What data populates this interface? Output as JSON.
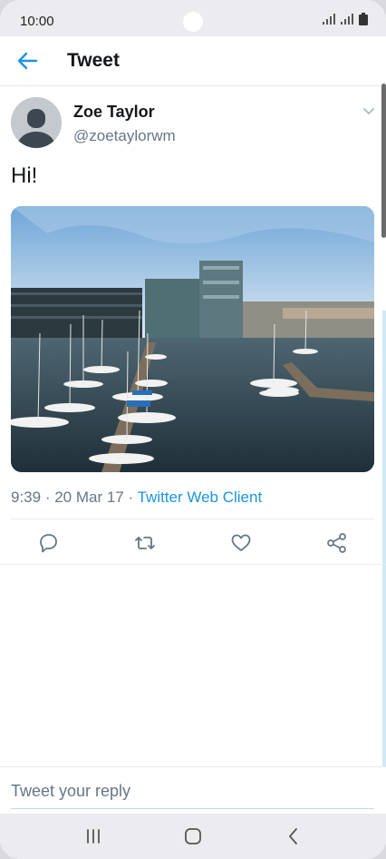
{
  "status_bar": {
    "time": "10:00"
  },
  "header": {
    "title": "Tweet"
  },
  "tweet": {
    "author_name": "Zoe Taylor",
    "author_handle": "@zoetaylorwm",
    "text": "Hi!",
    "time": "9:39",
    "date": "20 Mar 17",
    "separator": " · ",
    "source": "Twitter Web Client"
  },
  "reply": {
    "placeholder": "Tweet your reply"
  },
  "colors": {
    "accent": "#1b95e0",
    "secondary_text": "#657786",
    "primary_text": "#14171a"
  },
  "icons": [
    "back-arrow-icon",
    "chevron-down-icon",
    "reply-icon",
    "retweet-icon",
    "like-icon",
    "share-icon",
    "recents-icon",
    "home-icon",
    "back-icon"
  ]
}
